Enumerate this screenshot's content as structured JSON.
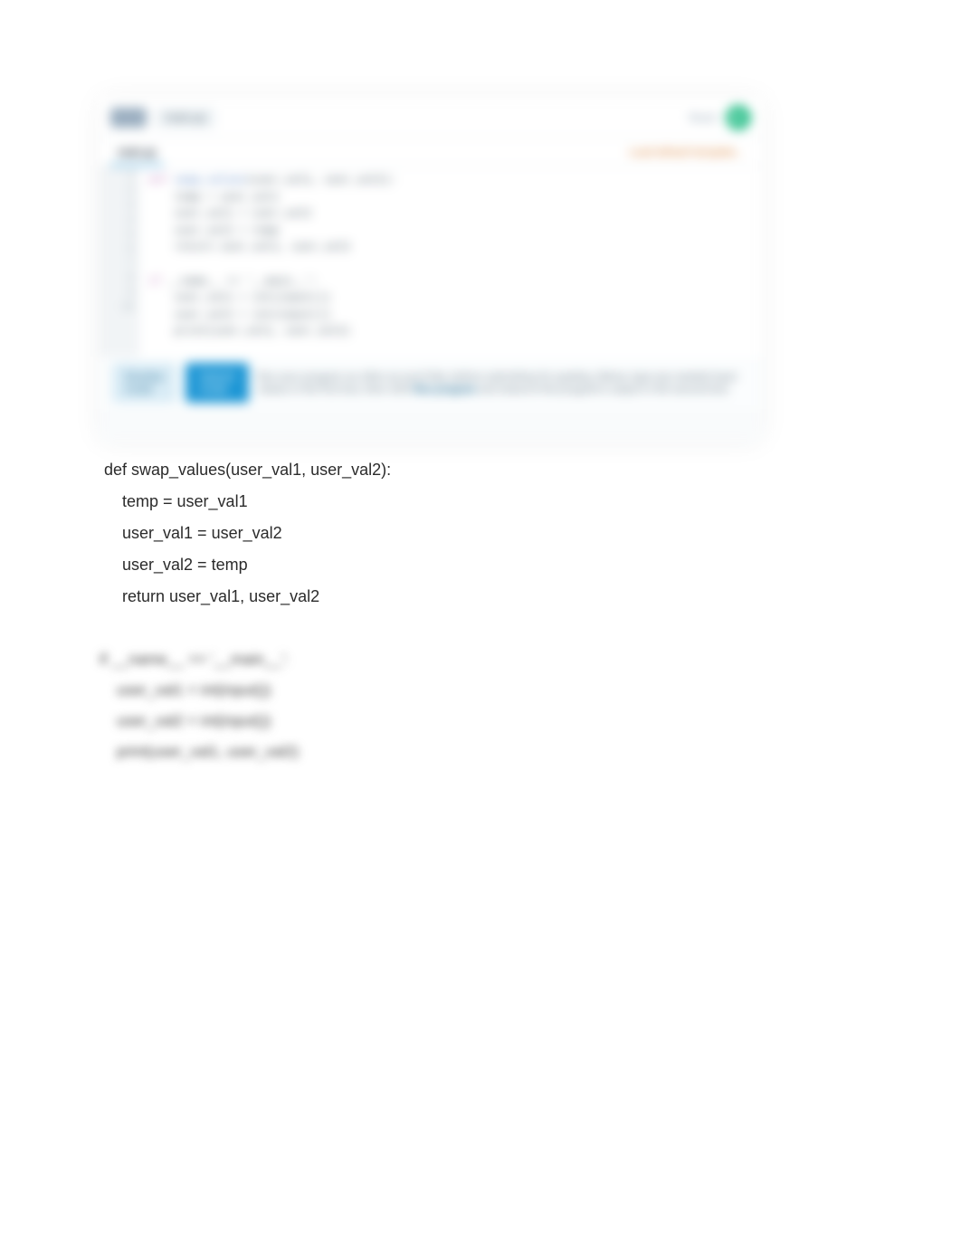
{
  "ide": {
    "filename": "main.py",
    "reset_label": "Reset",
    "tabs": {
      "active": "main.py",
      "right": "Load default template..."
    },
    "gutter": [
      "1",
      "2",
      "3",
      "4",
      "5",
      "6",
      "7",
      "8",
      "9",
      "10"
    ],
    "code_tokens": {
      "l1_kw": "def",
      "l1_fn": "swap_values",
      "l1_sig": "(user_val1, user_val2):",
      "l2": "    temp = user_val1",
      "l3": "    user_val1 = user_val2",
      "l4": "    user_val2 = temp",
      "l5": "    return user_val1, user_val2",
      "l6_blank": "",
      "l7_kw": "if",
      "l7_rest": " __name__ == '__main__':",
      "l8": "    user_val1 = int(input())",
      "l9": "    user_val2 = int(input())",
      "l10": "    print(user_val1, user_val2)"
    },
    "bottom": {
      "dev_btn": "Develop mode",
      "submit_btn": "Submit mode",
      "hint_pre": "Run your program as often as you'd like, before submitting for grading. Below, type any needed input values in the first box, then click ",
      "hint_bold": "Run program",
      "hint_post": " and observe the program's output in the second box."
    }
  },
  "sharp_code": {
    "line1": "def swap_values(user_val1, user_val2):",
    "line2": "    temp = user_val1",
    "line3": "    user_val1 = user_val2",
    "line4": "    user_val2 = temp",
    "line5": "    return user_val1, user_val2"
  },
  "blur_code": {
    "line1": "if __name__ == '__main__':",
    "line2": "    user_val1 = int(input())",
    "line3": "    user_val2 = int(input())",
    "line4": "    print(user_val1, user_val2)"
  }
}
